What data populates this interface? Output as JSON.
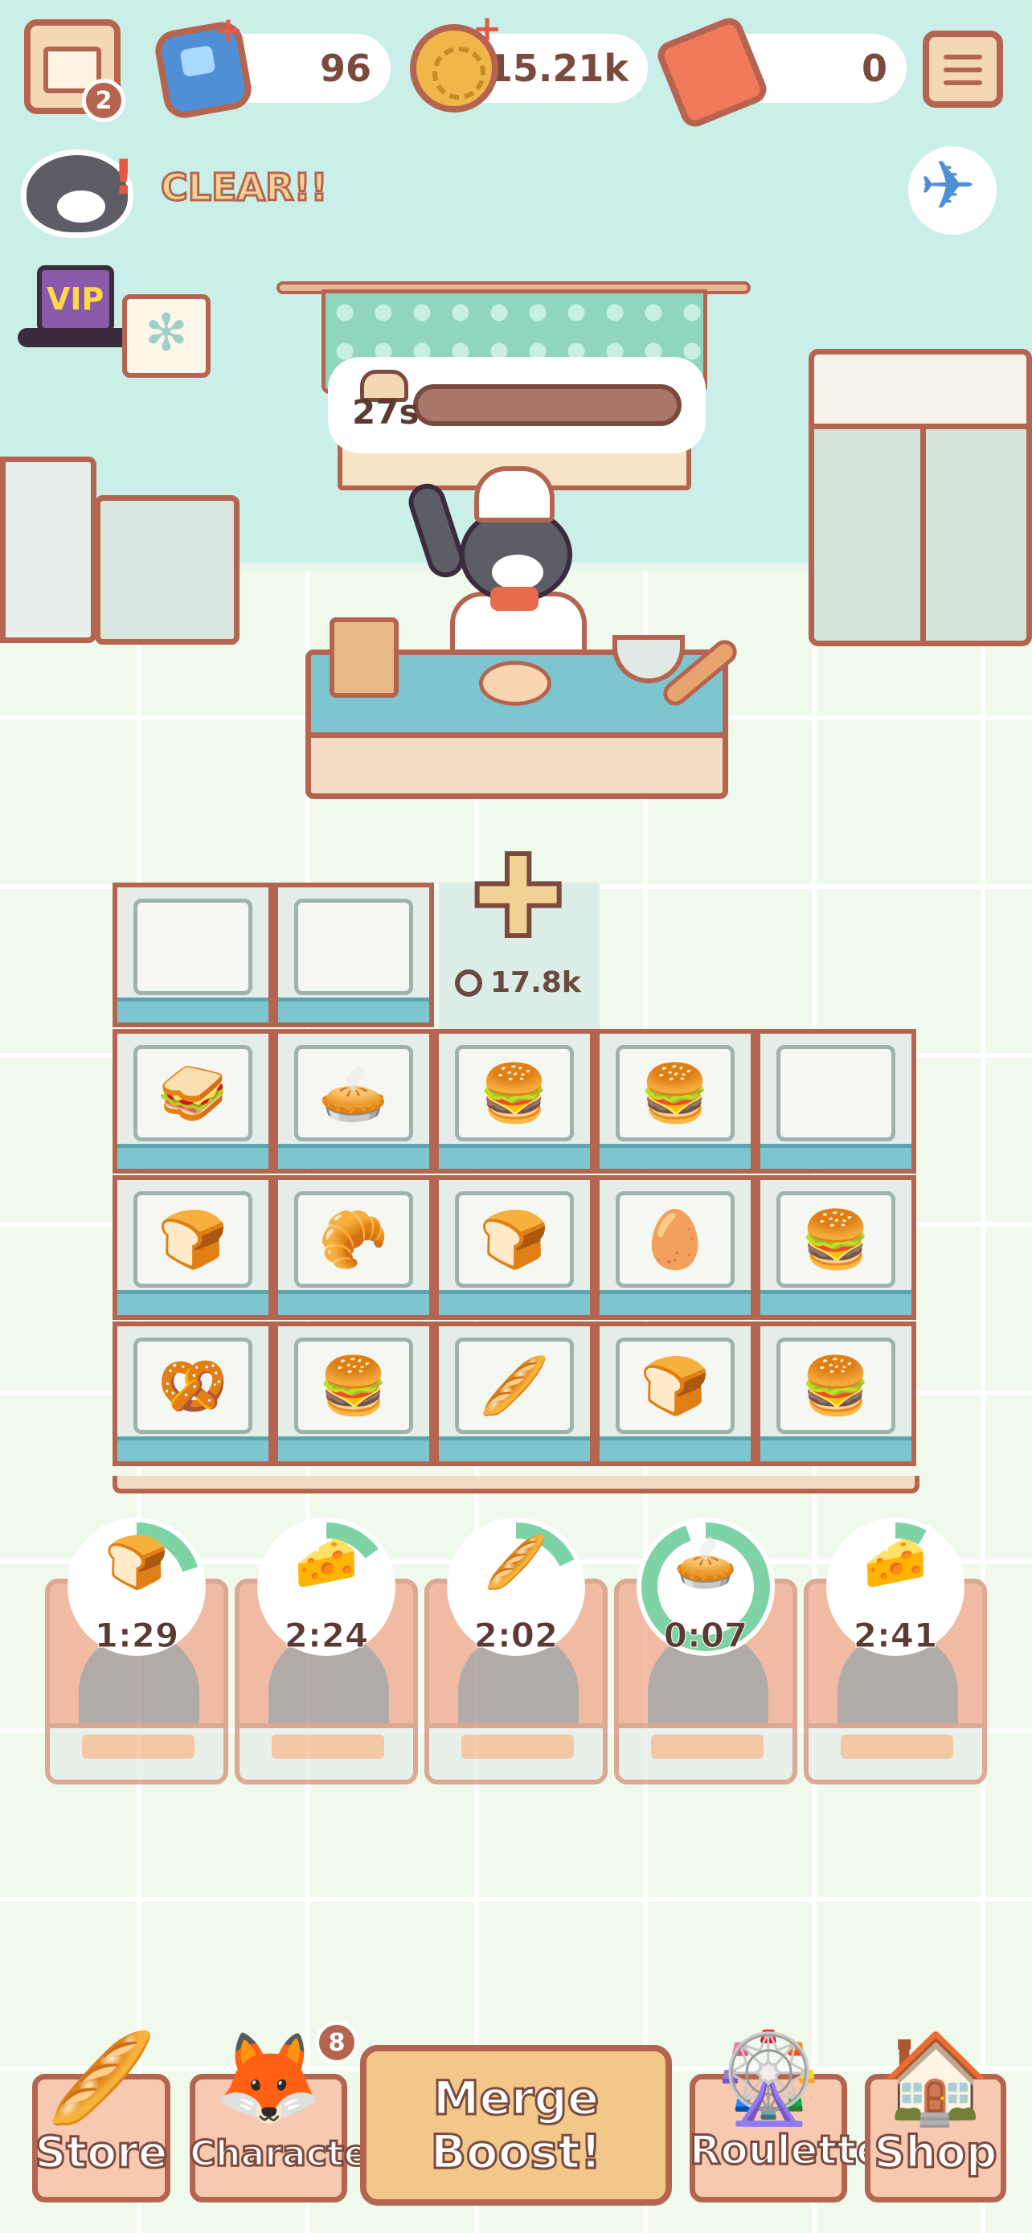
{
  "hud": {
    "quest_badge": "2",
    "gems": "96",
    "coins": "15.21k",
    "tickets": "0",
    "clear_label": "CLEAR!!",
    "vip_label": "VIP"
  },
  "baker": {
    "timer": "27s"
  },
  "merge_grid": {
    "unlock_cost": "17.8k",
    "rows": [
      [
        "empty",
        "empty",
        "locked",
        null,
        null
      ],
      [
        "sandwich",
        "pie",
        "burger",
        "burger",
        "empty"
      ],
      [
        "toast",
        "croissant",
        "toast",
        "dough",
        "burger"
      ],
      [
        "pretzel",
        "burger",
        "baguette",
        "loaf",
        "burger"
      ]
    ],
    "item_icons": {
      "sandwich": "🥪",
      "pie": "🥧",
      "burger": "🍔",
      "toast": "🍞",
      "croissant": "🥐",
      "dough": "🥚",
      "pretzel": "🥨",
      "baguette": "🥖",
      "loaf": "🍞"
    }
  },
  "ovens": [
    {
      "food": "toast",
      "icon": "🍞",
      "time": "1:29",
      "progress": 0.2
    },
    {
      "food": "cheese",
      "icon": "🧀",
      "time": "2:24",
      "progress": 0.15
    },
    {
      "food": "bread",
      "icon": "🥖",
      "time": "2:02",
      "progress": 0.18
    },
    {
      "food": "tart",
      "icon": "🥧",
      "time": "0:07",
      "progress": 0.95
    },
    {
      "food": "cheese",
      "icon": "🧀",
      "time": "2:41",
      "progress": 0.08
    }
  ],
  "colors": {
    "progress": "#7ed3a6",
    "accent": "#b5654f"
  },
  "nav": {
    "store": "Store",
    "character": "Character",
    "character_badge": "8",
    "merge_line1": "Merge",
    "merge_line2": "Boost!",
    "roulette": "Roulette",
    "shop": "Shop"
  }
}
